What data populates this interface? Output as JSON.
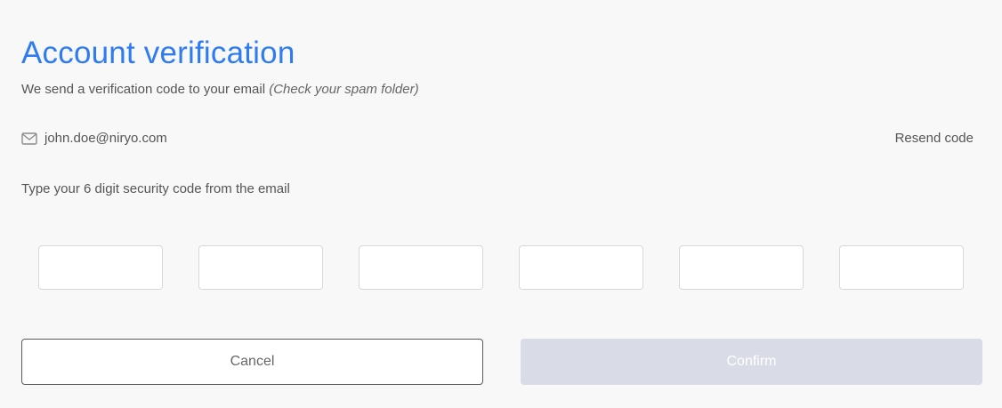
{
  "header": {
    "title": "Account verification",
    "subtitle": "We send a verification code to your email ",
    "subtitle_hint": "(Check your spam folder)"
  },
  "email": {
    "icon": "envelope-icon",
    "address": "john.doe@niryo.com",
    "resend_label": "Resend code"
  },
  "instruction": "Type your 6 digit security code from the email",
  "code_digits": [
    "",
    "",
    "",
    "",
    "",
    ""
  ],
  "buttons": {
    "cancel_label": "Cancel",
    "confirm_label": "Confirm"
  },
  "colors": {
    "accent": "#2f7cf0",
    "background": "#f8f8f8",
    "confirm_disabled_bg": "#d9dbe6"
  }
}
